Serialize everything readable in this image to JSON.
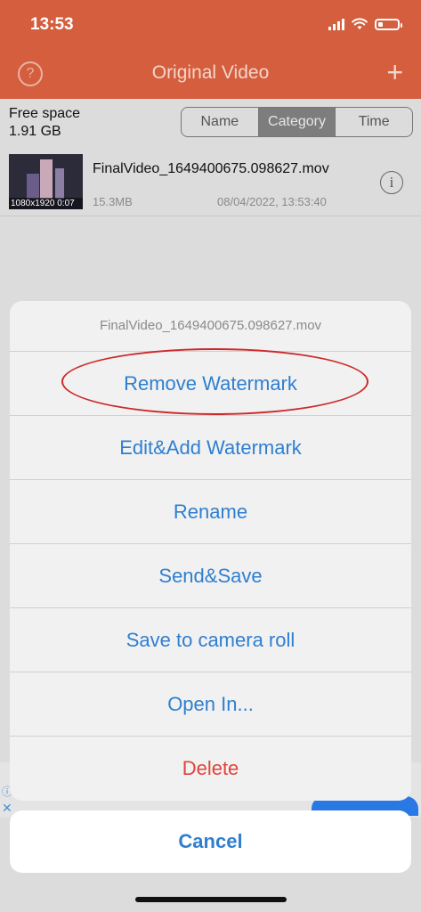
{
  "status_bar": {
    "time": "13:53"
  },
  "header": {
    "title": "Original Video"
  },
  "storage": {
    "label": "Free space",
    "value": "1.91 GB"
  },
  "sort_segment": [
    {
      "label": "Name",
      "selected": false
    },
    {
      "label": "Category",
      "selected": true
    },
    {
      "label": "Time",
      "selected": false
    }
  ],
  "file": {
    "thumbnail_caption": "1080x1920 0:07",
    "name": "FinalVideo_1649400675.098627.mov",
    "size": "15.3MB",
    "date": "08/04/2022, 13:53:40"
  },
  "action_sheet": {
    "title": "FinalVideo_1649400675.098627.mov",
    "items": [
      "Remove Watermark",
      "Edit&Add Watermark",
      "Rename",
      "Send&Save",
      "Save to camera roll",
      "Open In...",
      "Delete"
    ],
    "cancel": "Cancel"
  },
  "colors": {
    "header": "#d45e3d",
    "action_text": "#2f7fd0",
    "destructive": "#e0443c",
    "annotation": "#cc2a2a"
  }
}
